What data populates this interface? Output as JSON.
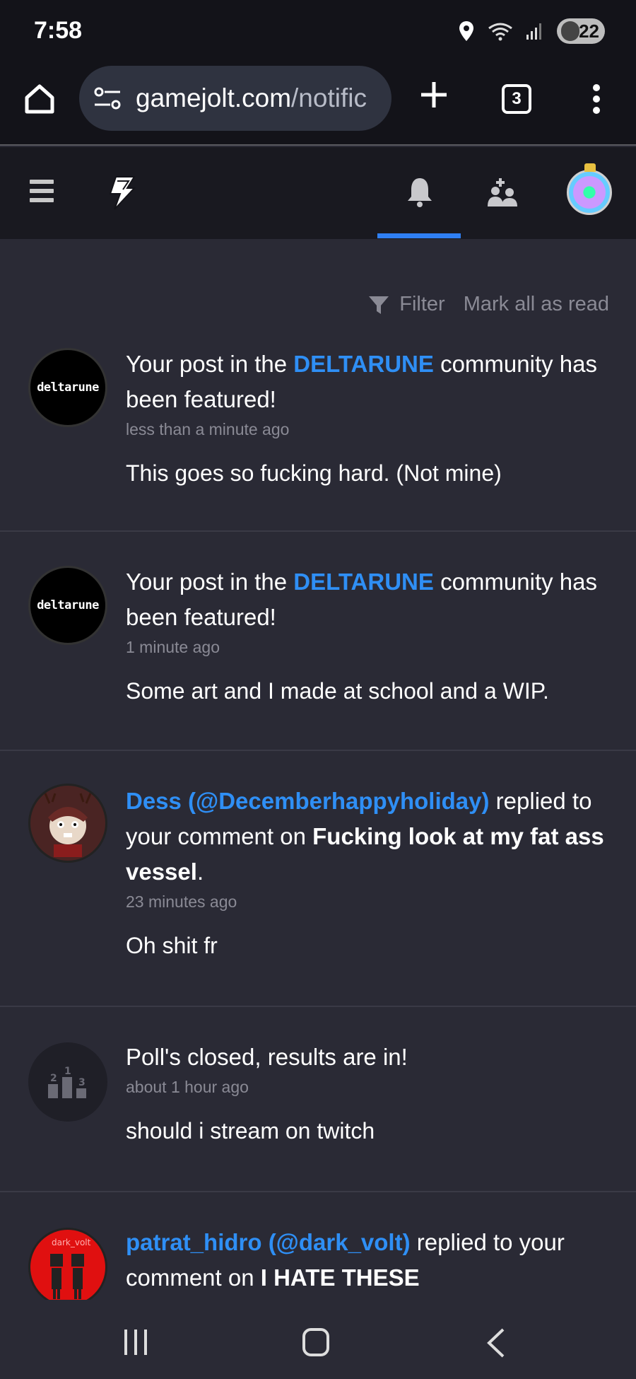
{
  "status": {
    "time": "7:58",
    "battery": "22",
    "icons": [
      "location-icon",
      "wifi-icon",
      "signal-icon",
      "battery-icon"
    ]
  },
  "browser": {
    "url_domain": "gamejolt.com",
    "url_path": "/notific",
    "tab_count": "3"
  },
  "nav": {
    "items": [
      "menu-icon",
      "gamejolt-logo",
      "notifications-bell-icon",
      "friends-icon",
      "user-avatar"
    ],
    "active_color": "#2f7ff3"
  },
  "actions": {
    "filter_label": "Filter",
    "mark_all_label": "Mark all as read"
  },
  "notifications": [
    {
      "title_pre": "Your post in the ",
      "title_link": "DELTARUNE",
      "title_post": " community has been featured!",
      "time": "less than a minute ago",
      "snippet": "This goes so fucking hard. (Not mine)",
      "avatar_text": "deltarune"
    },
    {
      "title_pre": "Your post in the ",
      "title_link": "DELTARUNE",
      "title_post": " community has been featured!",
      "time": "1 minute ago",
      "snippet": "Some art and I made at school and a WIP.",
      "avatar_text": "deltarune"
    },
    {
      "user": "Dess (@Decemberhappyholiday)",
      "action": " replied to your comment on ",
      "target": "Fucking look at my fat ass vessel",
      "end": ".",
      "time": "23 minutes ago",
      "snippet": "Oh shit fr"
    },
    {
      "title": "Poll's closed, results are in!",
      "time": "about 1 hour ago",
      "snippet": "should i stream on twitch"
    },
    {
      "user": "patrat_hidro (@dark_volt)",
      "action": " replied to your comment on ",
      "target": "I HATE THESE",
      "avatar_text": "dark_volt"
    }
  ],
  "colors": {
    "background": "#2a2a35",
    "link": "#2f8ff5",
    "muted": "#8a8a95"
  }
}
